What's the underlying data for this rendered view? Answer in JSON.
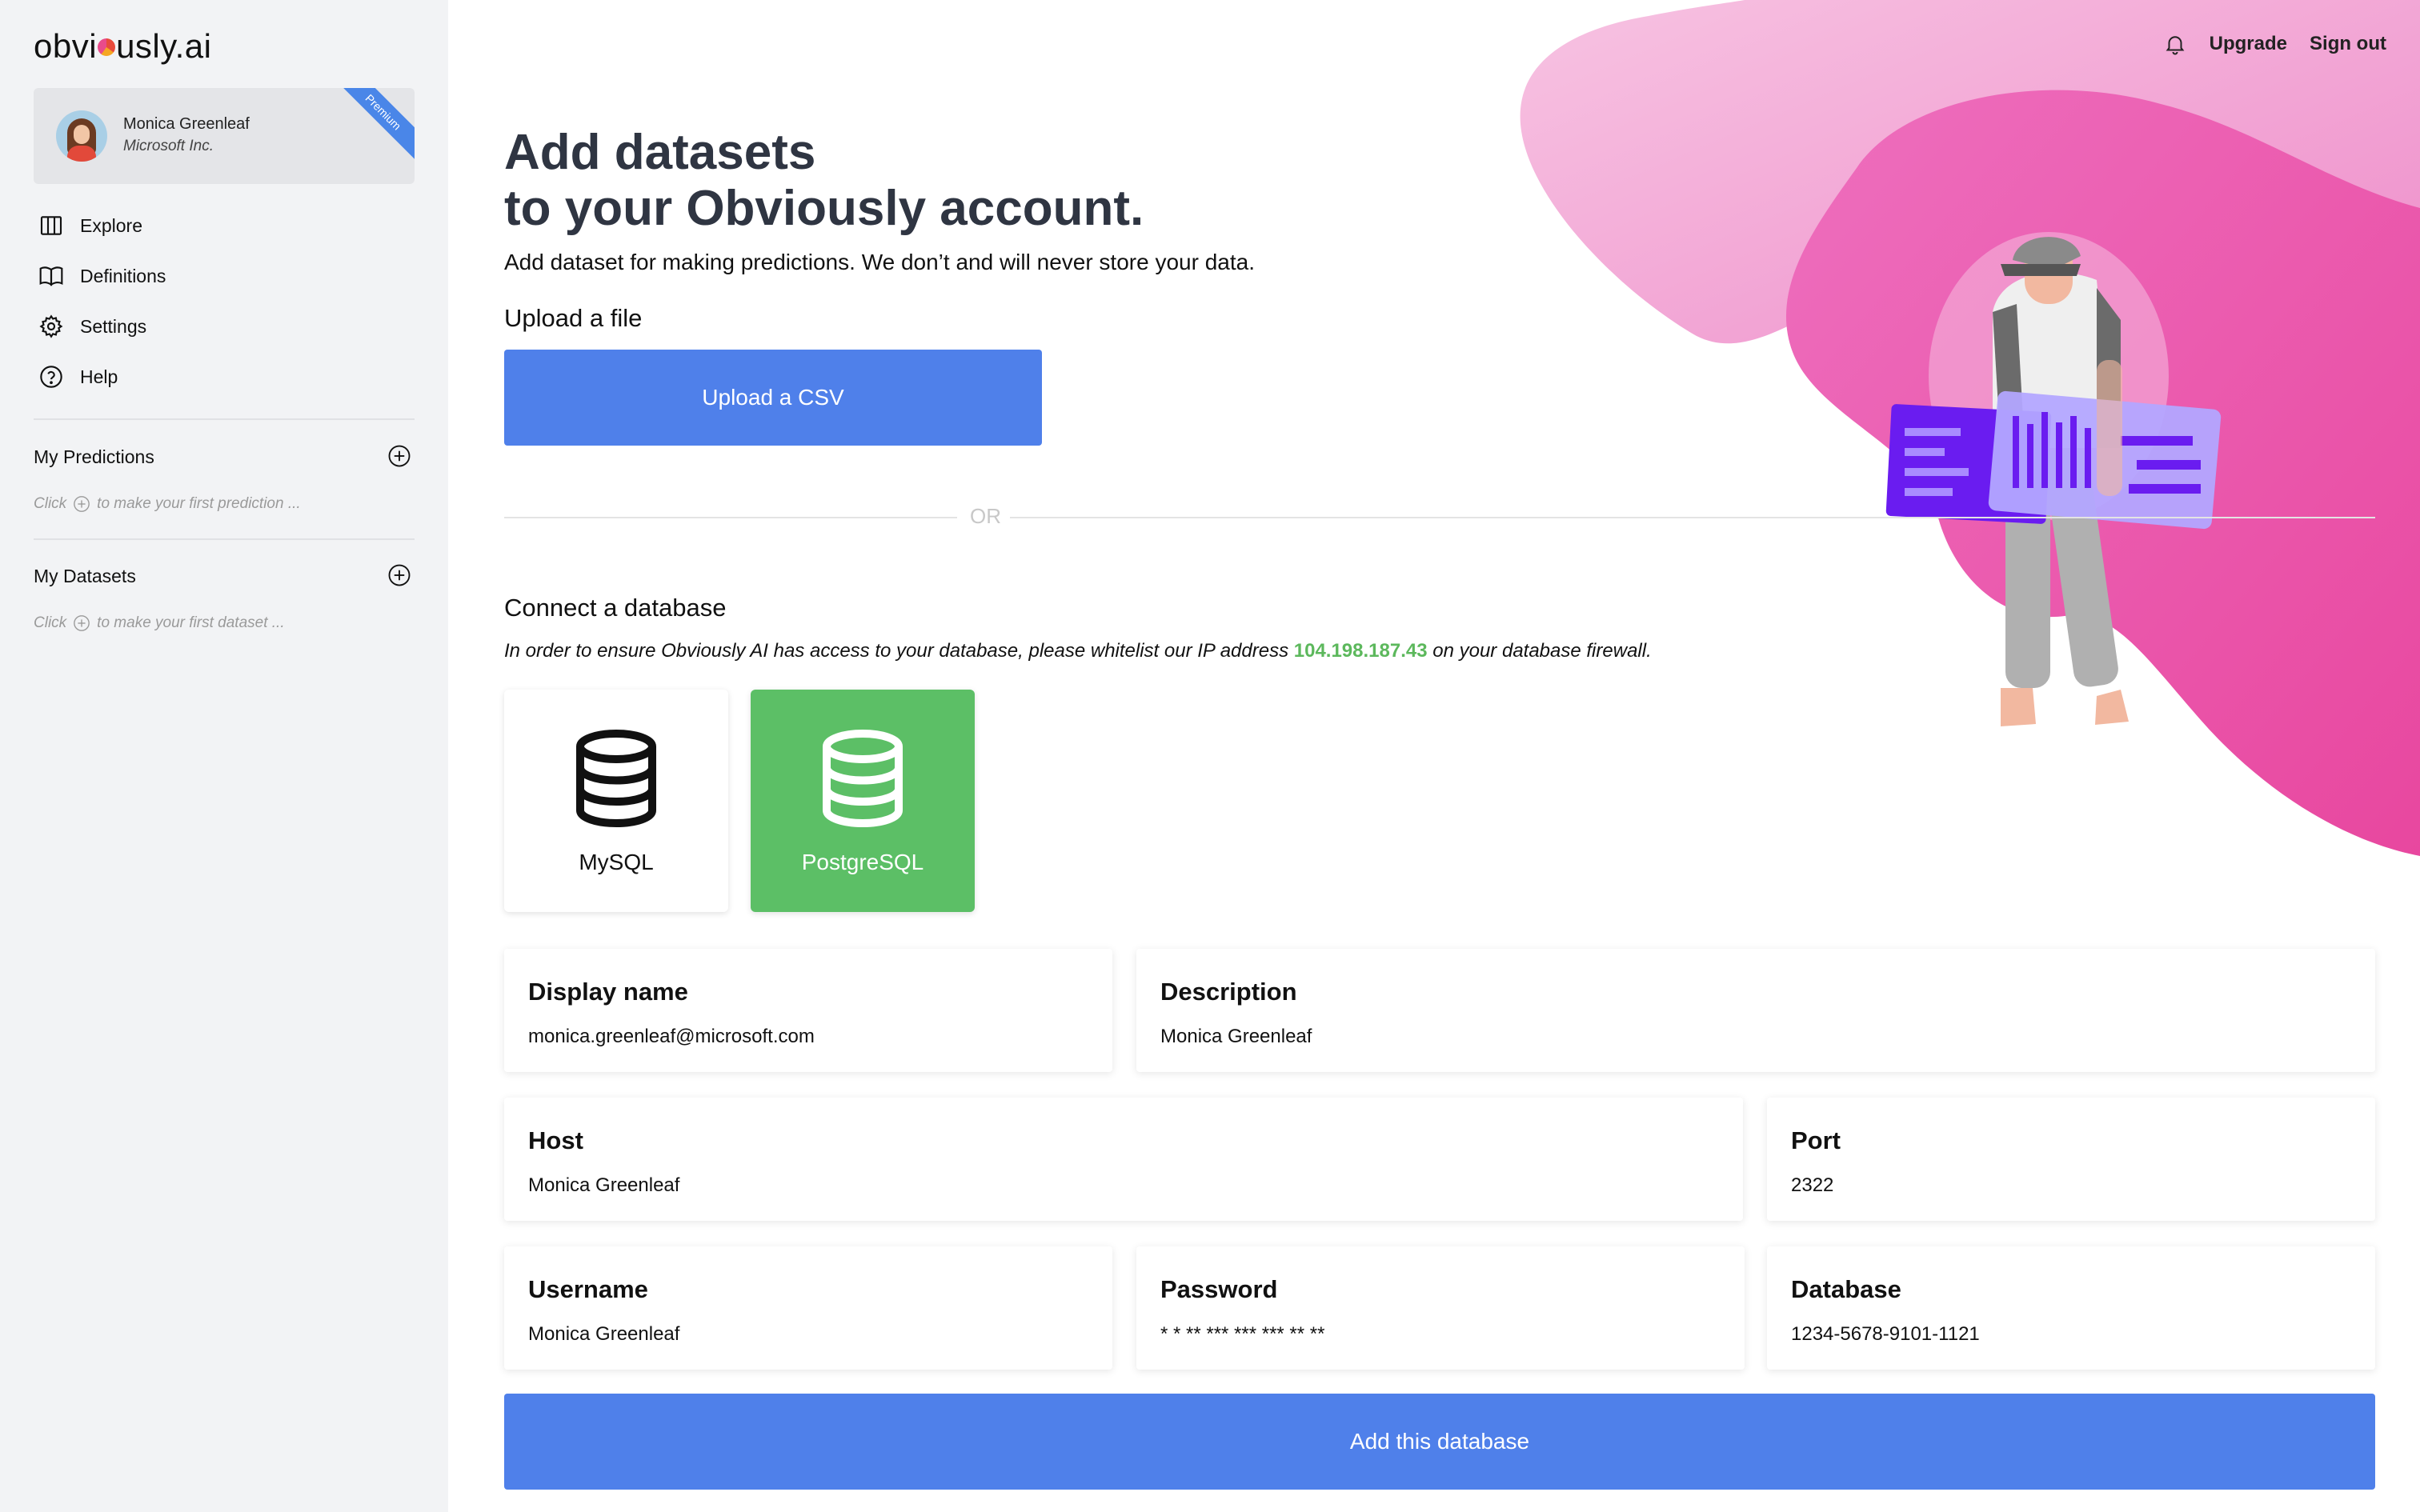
{
  "sidebar": {
    "logo_before": "obvi",
    "logo_after": "usly.ai",
    "profile": {
      "name": "Monica Greenleaf",
      "company": "Microsoft Inc.",
      "badge": "Premium"
    },
    "nav": [
      {
        "label": "Explore",
        "icon": "columns-icon"
      },
      {
        "label": "Definitions",
        "icon": "book-icon"
      },
      {
        "label": "Settings",
        "icon": "gear-icon"
      },
      {
        "label": "Help",
        "icon": "help-circle-icon"
      }
    ],
    "predictions": {
      "title": "My Predictions",
      "hint_before": "Click",
      "hint_after": "to make your first prediction ..."
    },
    "datasets": {
      "title": "My Datasets",
      "hint_before": "Click",
      "hint_after": "to make your first dataset ..."
    }
  },
  "topbar": {
    "notifications_icon": "bell-icon",
    "upgrade": "Upgrade",
    "signout": "Sign out"
  },
  "main": {
    "heading_line1": "Add datasets",
    "heading_line2": "to your Obviously account.",
    "subtitle": "Add dataset for making predictions. We don’t and will never store your data.",
    "upload_label": "Upload a file",
    "upload_button": "Upload a CSV",
    "or_text": "OR",
    "connect_label": "Connect a database",
    "ip_note_before": "In order to ensure Obviously AI has access to your database, please whitelist our IP address",
    "ip_address": "104.198.187.43",
    "ip_note_after": "on your database firewall.",
    "databases": [
      {
        "label": "MySQL",
        "selected": false
      },
      {
        "label": "PostgreSQL",
        "selected": true
      }
    ],
    "fields": {
      "display_name": {
        "label": "Display name",
        "value": "monica.greenleaf@microsoft.com"
      },
      "description": {
        "label": "Description",
        "value": "Monica Greenleaf"
      },
      "host": {
        "label": "Host",
        "value": "Monica Greenleaf"
      },
      "port": {
        "label": "Port",
        "value": "2322"
      },
      "username": {
        "label": "Username",
        "value": "Monica Greenleaf"
      },
      "password": {
        "label": "Password",
        "value": "* * ** *** *** *** ** **"
      },
      "database": {
        "label": "Database",
        "value": "1234-5678-9101-1121"
      }
    },
    "submit_button": "Add this database"
  },
  "colors": {
    "primary": "#4f80ea",
    "success": "#5cbf66",
    "ip": "#5cb85c",
    "blob_light": "#f3a8d6",
    "blob_dark": "#ec5bb3"
  }
}
